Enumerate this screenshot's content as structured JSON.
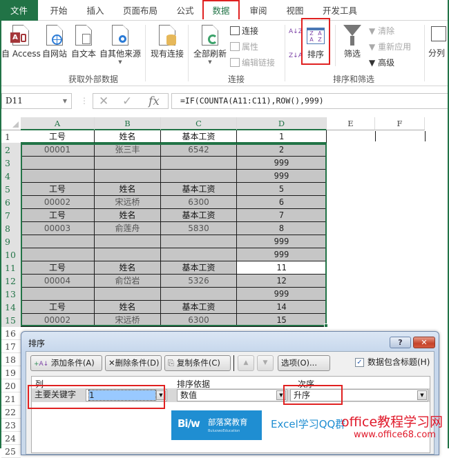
{
  "tabs": [
    {
      "label": "文件",
      "state": "file"
    },
    {
      "label": "开始"
    },
    {
      "label": "插入"
    },
    {
      "label": "页面布局"
    },
    {
      "label": "公式"
    },
    {
      "label": "数据",
      "state": "active"
    },
    {
      "label": "审阅"
    },
    {
      "label": "视图"
    },
    {
      "label": "开发工具"
    }
  ],
  "ribbon": {
    "get_external": {
      "group_label": "获取外部数据",
      "buttons": [
        "自 Access",
        "自网站",
        "自文本",
        "自其他来源"
      ],
      "existing": "现有连接"
    },
    "connections": {
      "group_label": "连接",
      "refresh_all": "全部刷新",
      "connections": "连接",
      "properties": "属性",
      "edit_links": "编辑链接"
    },
    "sort_filter": {
      "group_label": "排序和筛选",
      "sort_az": "A↓Z",
      "sort_za": "Z↓A",
      "sort": "排序",
      "filter": "筛选",
      "clear": "清除",
      "reapply": "重新应用",
      "advanced": "高级"
    },
    "data_tools": {
      "text_to_columns": "分列"
    }
  },
  "formula_bar": {
    "name_box": "D11",
    "cancel_icon": "✕",
    "enter_icon": "✓",
    "fx_label": "fx",
    "formula": "=IF(COUNTA(A11:C11),ROW(),999)"
  },
  "sheet": {
    "columns": [
      "A",
      "B",
      "C",
      "D",
      "E",
      "F"
    ],
    "rows": [
      [
        "工号",
        "姓名",
        "基本工资",
        "1"
      ],
      [
        "00001",
        "张三丰",
        "6542",
        "2"
      ],
      [
        "",
        "",
        "",
        "999"
      ],
      [
        "",
        "",
        "",
        "999"
      ],
      [
        "工号",
        "姓名",
        "基本工资",
        "5"
      ],
      [
        "00002",
        "宋远桥",
        "6300",
        "6"
      ],
      [
        "工号",
        "姓名",
        "基本工资",
        "7"
      ],
      [
        "00003",
        "俞莲舟",
        "5830",
        "8"
      ],
      [
        "",
        "",
        "",
        "999"
      ],
      [
        "",
        "",
        "",
        "999"
      ],
      [
        "工号",
        "姓名",
        "基本工资",
        "11"
      ],
      [
        "00004",
        "俞岱岩",
        "5326",
        "12"
      ],
      [
        "",
        "",
        "",
        "999"
      ],
      [
        "工号",
        "姓名",
        "基本工资",
        "14"
      ],
      [
        "00002",
        "宋远桥",
        "6300",
        "15"
      ]
    ],
    "row_numbers": [
      "1",
      "2",
      "3",
      "4",
      "5",
      "6",
      "7",
      "8",
      "9",
      "10",
      "11",
      "12",
      "13",
      "14",
      "15",
      "16",
      "17",
      "18",
      "19",
      "20",
      "21",
      "22",
      "23",
      "24",
      "25"
    ],
    "active_cell": "D11",
    "selection": "A2:D15"
  },
  "dialog": {
    "title": "排序",
    "help": "?",
    "close": "✕",
    "add_level": "添加条件(A)",
    "delete_level": "删除条件(D)",
    "copy_level": "复制条件(C)",
    "move_up": "▲",
    "move_down": "▼",
    "options": "选项(O)...",
    "has_headers_label": "数据包含标题(H)",
    "has_headers_checked": true,
    "col_header": "列",
    "sort_on_header": "排序依据",
    "order_header": "次序",
    "row": {
      "label": "主要关键字",
      "column_value": "1",
      "sort_on_value": "数值",
      "order_value": "升序"
    }
  },
  "watermark": {
    "logo_mark": "Bi/w",
    "logo_name": "部落窝教育",
    "logo_sub": "BuluowoEducation",
    "qq_text": "Excel学习QQ群",
    "site_name": "office教程学习网",
    "site_url": "www.office68.com"
  },
  "colors": {
    "excel_green": "#217346",
    "highlight_red": "#e02020",
    "selection_gray": "#c6c6c6",
    "logo_blue": "#1f8ed2"
  }
}
